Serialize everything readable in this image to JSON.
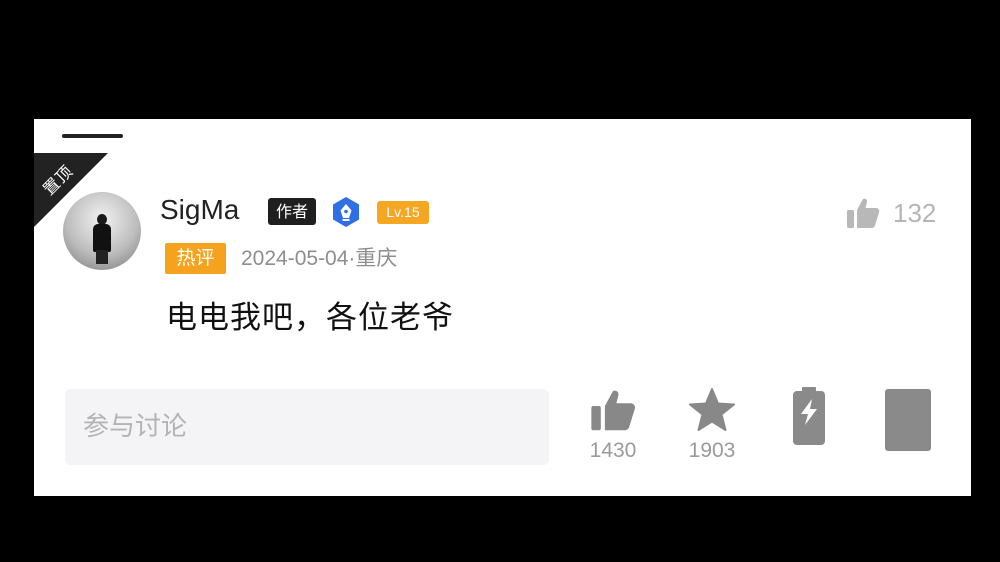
{
  "comment": {
    "pinned_label": "置顶",
    "username": "SigMa",
    "author_badge": "作者",
    "level_badge": "Lv.15",
    "hot_badge": "热评",
    "meta": "2024-05-04·重庆",
    "content": "电电我吧，各位老爷",
    "like_count": "132"
  },
  "bottom_bar": {
    "input_placeholder": "参与讨论",
    "like_count": "1430",
    "favorite_count": "1903"
  },
  "colors": {
    "badge_orange": "#f5a623",
    "verify_blue": "#2f6fe6",
    "icon_gray": "#8a8a8a"
  }
}
